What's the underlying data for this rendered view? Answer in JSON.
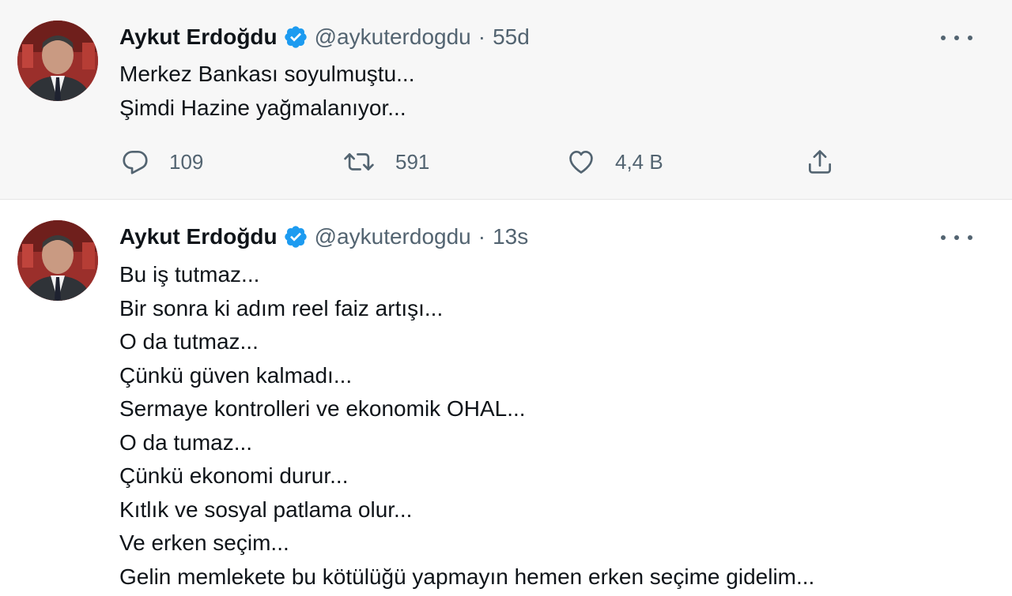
{
  "tweets": [
    {
      "author": {
        "name": "Aykut Erdoğdu",
        "handle": "@aykuterdogdu",
        "verified": true
      },
      "separator": "·",
      "time": "55d",
      "lines": [
        "Merkez Bankası soyulmuştu...",
        "Şimdi Hazine yağmalanıyor..."
      ],
      "stats": {
        "replies": "109",
        "retweets": "591",
        "likes": "4,4 B"
      }
    },
    {
      "author": {
        "name": "Aykut Erdoğdu",
        "handle": "@aykuterdogdu",
        "verified": true
      },
      "separator": "·",
      "time": "13s",
      "lines": [
        "Bu iş tutmaz...",
        "Bir sonra ki adım reel faiz artışı...",
        "O da tutmaz...",
        "Çünkü güven kalmadı...",
        "Sermaye kontrolleri ve ekonomik OHAL...",
        "O da tumaz...",
        "Çünkü ekonomi durur...",
        "Kıtlık ve sosyal patlama olur...",
        "Ve erken seçim...",
        "Gelin memlekete bu kötülüğü yapmayın hemen erken seçime gidelim..."
      ]
    }
  ],
  "colors": {
    "verified": "#1d9bf0",
    "secondary_text": "#536471",
    "primary_text": "#0f1419",
    "tweet1_bg": "#f7f7f7"
  },
  "icons": [
    "verified-badge-icon",
    "more-icon",
    "reply-icon",
    "retweet-icon",
    "like-icon",
    "share-icon"
  ]
}
